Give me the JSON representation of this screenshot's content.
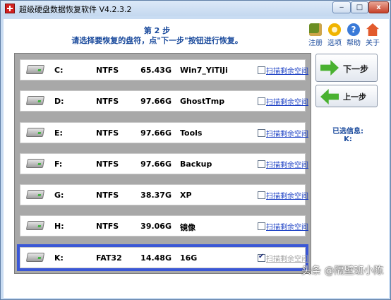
{
  "window": {
    "title": "超级硬盘数据恢复软件 V4.2.3.2",
    "min_label": "‒",
    "max_label": "□",
    "close_label": "x"
  },
  "header": {
    "step_title": "第 2 步",
    "step_desc": "请选择要恢复的盘符，点\"下一步\"按钮进行恢复。"
  },
  "toolbar": {
    "items": [
      {
        "label": "注册",
        "icon": "register-icon"
      },
      {
        "label": "选项",
        "icon": "options-gear-icon"
      },
      {
        "label": "帮助",
        "icon": "help-icon"
      },
      {
        "label": "关于",
        "icon": "about-house-icon"
      }
    ],
    "help_glyph": "?"
  },
  "disks": [
    {
      "letter": "C:",
      "fs": "NTFS",
      "size": "65.43G",
      "label": "Win7_YiTiJi",
      "scan": "扫描剩余空间",
      "checked": false,
      "selected": false
    },
    {
      "letter": "D:",
      "fs": "NTFS",
      "size": "97.66G",
      "label": "GhostTmp",
      "scan": "扫描剩余空间",
      "checked": false,
      "selected": false
    },
    {
      "letter": "E:",
      "fs": "NTFS",
      "size": "97.66G",
      "label": "Tools",
      "scan": "扫描剩余空间",
      "checked": false,
      "selected": false
    },
    {
      "letter": "F:",
      "fs": "NTFS",
      "size": "97.66G",
      "label": "Backup",
      "scan": "扫描剩余空间",
      "checked": false,
      "selected": false
    },
    {
      "letter": "G:",
      "fs": "NTFS",
      "size": "38.37G",
      "label": "XP",
      "scan": "扫描剩余空间",
      "checked": false,
      "selected": false
    },
    {
      "letter": "H:",
      "fs": "NTFS",
      "size": "39.06G",
      "label": "镜像",
      "scan": "扫描剩余空间",
      "checked": false,
      "selected": false
    },
    {
      "letter": "K:",
      "fs": "FAT32",
      "size": "14.48G",
      "label": "16G",
      "scan": "扫描剩余空间",
      "checked": true,
      "selected": true
    }
  ],
  "actions": {
    "next_label": "下一步",
    "prev_label": "上一步"
  },
  "selected_info": {
    "label": "已选信息:",
    "value": "K:"
  },
  "watermark": "头条 @隔壁班小陈"
}
